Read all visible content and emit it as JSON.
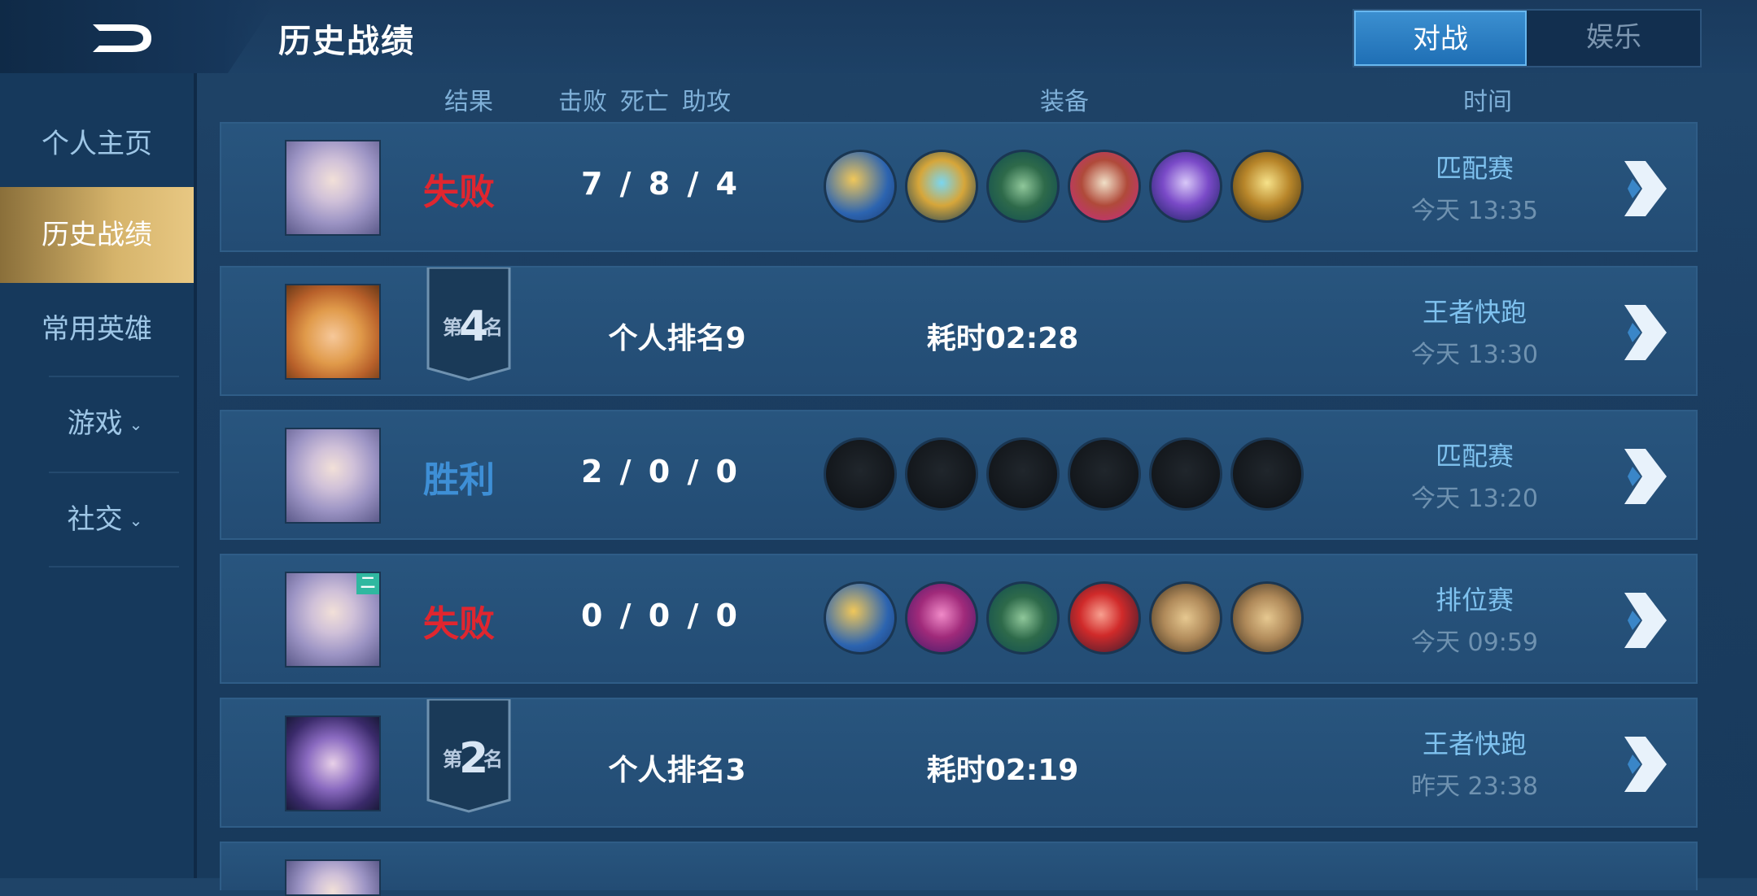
{
  "header": {
    "title": "历史战绩",
    "tabs": [
      {
        "label": "对战",
        "active": true
      },
      {
        "label": "娱乐",
        "active": false
      }
    ]
  },
  "sidebar": {
    "items": [
      {
        "label": "个人主页",
        "active": false
      },
      {
        "label": "历史战绩",
        "active": true
      },
      {
        "label": "常用英雄",
        "active": false
      },
      {
        "label": "游戏",
        "expandable": true
      },
      {
        "label": "社交",
        "expandable": true
      }
    ]
  },
  "columns": {
    "result": "结果",
    "kills": "击败",
    "deaths": "死亡",
    "assists": "助攻",
    "equipment": "装备",
    "time": "时间"
  },
  "colors": {
    "loss": "#e0262f",
    "win": "#3e8fd6",
    "accent_gold": "#d6b46b"
  },
  "matches": [
    {
      "type": "standard",
      "result": "失败",
      "result_color": "#e0262f",
      "kda": "7 / 8 / 4",
      "hero": "white-hair-heroine",
      "items": [
        "gold-blade",
        "gold-crest",
        "green-boots",
        "red-mask",
        "purple-axe",
        "gold-staff"
      ],
      "mode": "匹配赛",
      "time": "今天 13:35"
    },
    {
      "type": "race",
      "rank_prefix": "第",
      "rank_num": "4",
      "rank_suffix": "名",
      "personal_rank": "个人排名9",
      "duration": "耗时02:28",
      "hero": "goggles-girl",
      "mode": "王者快跑",
      "time": "今天 13:30"
    },
    {
      "type": "standard",
      "result": "胜利",
      "result_color": "#3e8fd6",
      "kda": "2 / 0 / 0",
      "hero": "white-hair-heroine",
      "items": [
        "empty",
        "empty",
        "empty",
        "empty",
        "empty",
        "empty"
      ],
      "mode": "匹配赛",
      "time": "今天 13:20"
    },
    {
      "type": "standard",
      "result": "失败",
      "result_color": "#e0262f",
      "kda": "0 / 0 / 0",
      "hero": "white-hair-heroine",
      "hero_badge": "二",
      "items": [
        "gold-blade",
        "purple-amulet",
        "green-boots",
        "red-gem",
        "wood-crate",
        "wood-crate"
      ],
      "mode": "排位赛",
      "time": "今天 09:59"
    },
    {
      "type": "race",
      "rank_prefix": "第",
      "rank_num": "2",
      "rank_suffix": "名",
      "personal_rank": "个人排名3",
      "duration": "耗时02:19",
      "hero": "armored-knight",
      "mode": "王者快跑",
      "time": "昨天 23:38"
    }
  ]
}
